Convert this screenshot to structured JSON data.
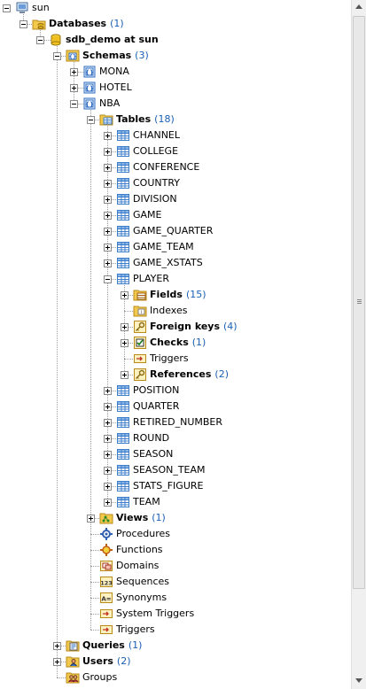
{
  "tree": [
    {
      "level": 0,
      "label": "sun",
      "icon": "computer-icon",
      "expander": "minus",
      "name": "tree-node-sun"
    },
    {
      "level": 1,
      "label": "Databases",
      "count": "(1)",
      "bold": true,
      "icon": "folder-db-icon",
      "expander": "minus",
      "name": "tree-node-databases"
    },
    {
      "level": 2,
      "label": "sdb_demo at sun",
      "bold": true,
      "icon": "database-icon",
      "expander": "minus",
      "name": "tree-node-sdb-demo"
    },
    {
      "level": 3,
      "label": "Schemas",
      "count": "(3)",
      "bold": true,
      "icon": "schemas-icon",
      "expander": "minus",
      "name": "tree-node-schemas"
    },
    {
      "level": 4,
      "label": "MONA",
      "icon": "schema-icon",
      "expander": "plus",
      "name": "tree-node-mona"
    },
    {
      "level": 4,
      "label": "HOTEL",
      "icon": "schema-icon",
      "expander": "plus",
      "name": "tree-node-hotel"
    },
    {
      "level": 4,
      "label": "NBA",
      "icon": "schema-icon",
      "expander": "minus",
      "name": "tree-node-nba"
    },
    {
      "level": 5,
      "label": "Tables",
      "count": "(18)",
      "bold": true,
      "icon": "tables-folder-icon",
      "expander": "minus",
      "name": "tree-node-tables"
    },
    {
      "level": 6,
      "label": "CHANNEL",
      "icon": "table-icon",
      "expander": "plus",
      "name": "tree-node-table"
    },
    {
      "level": 6,
      "label": "COLLEGE",
      "icon": "table-icon",
      "expander": "plus",
      "name": "tree-node-table"
    },
    {
      "level": 6,
      "label": "CONFERENCE",
      "icon": "table-icon",
      "expander": "plus",
      "name": "tree-node-table"
    },
    {
      "level": 6,
      "label": "COUNTRY",
      "icon": "table-icon",
      "expander": "plus",
      "name": "tree-node-table"
    },
    {
      "level": 6,
      "label": "DIVISION",
      "icon": "table-icon",
      "expander": "plus",
      "name": "tree-node-table"
    },
    {
      "level": 6,
      "label": "GAME",
      "icon": "table-icon",
      "expander": "plus",
      "name": "tree-node-table"
    },
    {
      "level": 6,
      "label": "GAME_QUARTER",
      "icon": "table-icon",
      "expander": "plus",
      "name": "tree-node-table"
    },
    {
      "level": 6,
      "label": "GAME_TEAM",
      "icon": "table-icon",
      "expander": "plus",
      "name": "tree-node-table"
    },
    {
      "level": 6,
      "label": "GAME_XSTATS",
      "icon": "table-icon",
      "expander": "plus",
      "name": "tree-node-table"
    },
    {
      "level": 6,
      "label": "PLAYER",
      "icon": "table-icon",
      "expander": "minus",
      "name": "tree-node-player"
    },
    {
      "level": 7,
      "label": "Fields",
      "count": "(15)",
      "bold": true,
      "icon": "fields-icon",
      "expander": "plus",
      "name": "tree-node-fields"
    },
    {
      "level": 7,
      "label": "Indexes",
      "icon": "indexes-icon",
      "expander": "none",
      "name": "tree-node-indexes"
    },
    {
      "level": 7,
      "label": "Foreign keys",
      "count": "(4)",
      "bold": true,
      "icon": "key-icon",
      "expander": "plus",
      "name": "tree-node-foreign-keys"
    },
    {
      "level": 7,
      "label": "Checks",
      "count": "(1)",
      "bold": true,
      "icon": "check-icon",
      "expander": "plus",
      "name": "tree-node-checks"
    },
    {
      "level": 7,
      "label": "Triggers",
      "icon": "trigger-icon",
      "expander": "none",
      "name": "tree-node-triggers"
    },
    {
      "level": 7,
      "label": "References",
      "count": "(2)",
      "bold": true,
      "icon": "key-icon",
      "expander": "plus",
      "name": "tree-node-references"
    },
    {
      "level": 6,
      "label": "POSITION",
      "icon": "table-icon",
      "expander": "plus",
      "name": "tree-node-table"
    },
    {
      "level": 6,
      "label": "QUARTER",
      "icon": "table-icon",
      "expander": "plus",
      "name": "tree-node-table"
    },
    {
      "level": 6,
      "label": "RETIRED_NUMBER",
      "icon": "table-icon",
      "expander": "plus",
      "name": "tree-node-table"
    },
    {
      "level": 6,
      "label": "ROUND",
      "icon": "table-icon",
      "expander": "plus",
      "name": "tree-node-table"
    },
    {
      "level": 6,
      "label": "SEASON",
      "icon": "table-icon",
      "expander": "plus",
      "name": "tree-node-table"
    },
    {
      "level": 6,
      "label": "SEASON_TEAM",
      "icon": "table-icon",
      "expander": "plus",
      "name": "tree-node-table"
    },
    {
      "level": 6,
      "label": "STATS_FIGURE",
      "icon": "table-icon",
      "expander": "plus",
      "name": "tree-node-table"
    },
    {
      "level": 6,
      "label": "TEAM",
      "icon": "table-icon",
      "expander": "plus",
      "name": "tree-node-table"
    },
    {
      "level": 5,
      "label": "Views",
      "count": "(1)",
      "bold": true,
      "icon": "views-icon",
      "expander": "plus",
      "name": "tree-node-views"
    },
    {
      "level": 5,
      "label": "Procedures",
      "icon": "procedures-icon",
      "expander": "none",
      "name": "tree-node-procedures"
    },
    {
      "level": 5,
      "label": "Functions",
      "icon": "functions-icon",
      "expander": "none",
      "name": "tree-node-functions"
    },
    {
      "level": 5,
      "label": "Domains",
      "icon": "domains-icon",
      "expander": "none",
      "name": "tree-node-domains"
    },
    {
      "level": 5,
      "label": "Sequences",
      "icon": "sequences-icon",
      "expander": "none",
      "name": "tree-node-sequences"
    },
    {
      "level": 5,
      "label": "Synonyms",
      "icon": "synonyms-icon",
      "expander": "none",
      "name": "tree-node-synonyms"
    },
    {
      "level": 5,
      "label": "System Triggers",
      "icon": "trigger-icon",
      "expander": "none",
      "name": "tree-node-system-triggers"
    },
    {
      "level": 5,
      "label": "Triggers",
      "icon": "trigger-icon",
      "expander": "none",
      "name": "tree-node-schema-triggers"
    },
    {
      "level": 3,
      "label": "Queries",
      "count": "(1)",
      "bold": true,
      "icon": "queries-icon",
      "expander": "plus",
      "name": "tree-node-queries"
    },
    {
      "level": 3,
      "label": "Users",
      "count": "(2)",
      "bold": true,
      "icon": "users-icon",
      "expander": "plus",
      "name": "tree-node-users"
    },
    {
      "level": 3,
      "label": "Groups",
      "icon": "groups-icon",
      "expander": "none",
      "name": "tree-node-groups"
    }
  ],
  "colors": {
    "count": "#1a5fb4",
    "folder": "#f2c94c",
    "table": "#3d7ecb",
    "schema": "#2d6cc0"
  },
  "scrollbar": {
    "up_icon": "arrow-up-icon",
    "down_icon": "arrow-down-icon"
  }
}
